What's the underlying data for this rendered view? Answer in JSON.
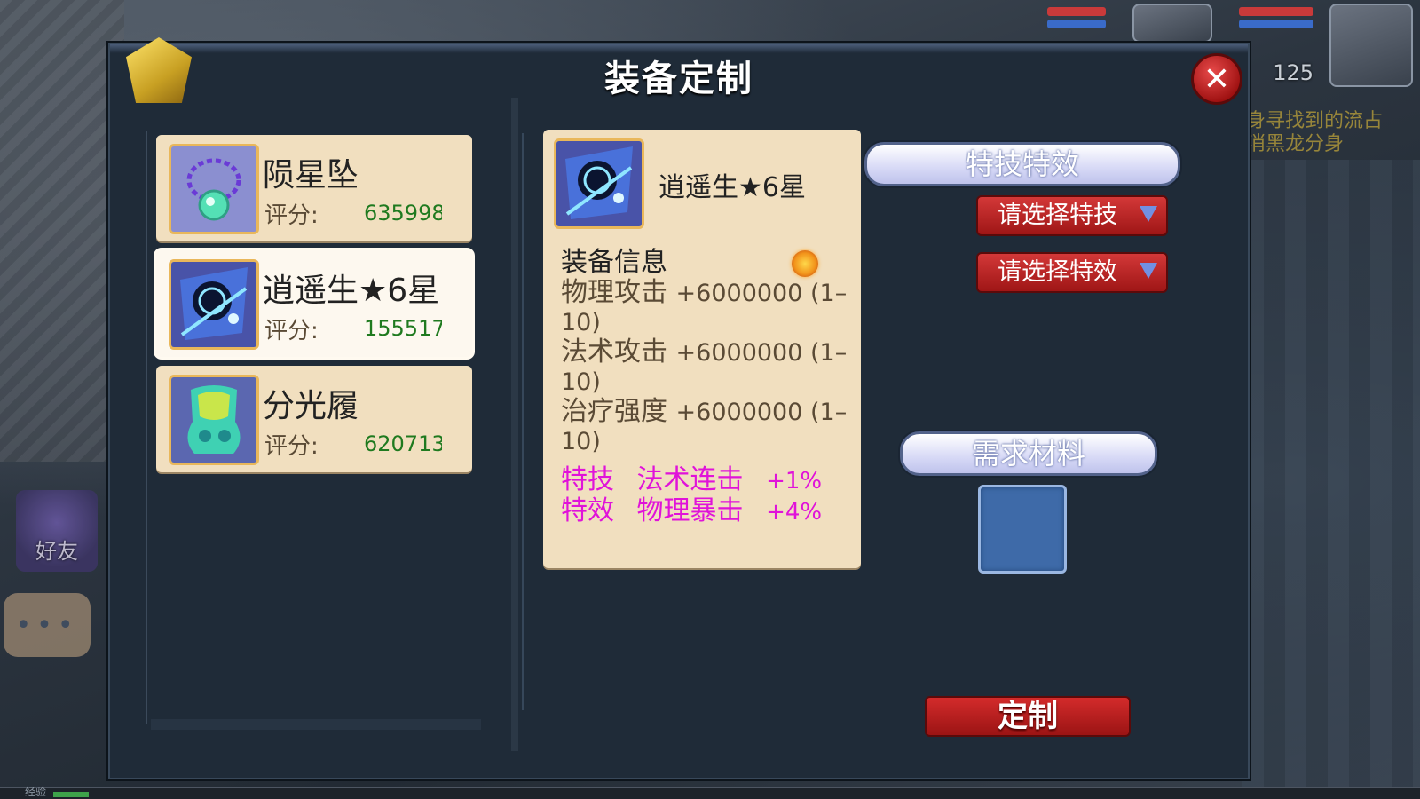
{
  "dialog": {
    "title": "装备定制",
    "close_glyph": "✕"
  },
  "equipment_list": [
    {
      "name": "陨星坠",
      "score_label": "评分:",
      "score": "635998",
      "selected": false,
      "icon": "necklace-icon"
    },
    {
      "name": "逍遥生★6星",
      "score_label": "评分:",
      "score": "155517:",
      "selected": true,
      "icon": "weapon-fan-icon"
    },
    {
      "name": "分光履",
      "score_label": "评分:",
      "score": "620713",
      "selected": false,
      "icon": "boots-icon"
    }
  ],
  "detail": {
    "name": "逍遥生★6星",
    "section_title": "装备信息",
    "stats": [
      {
        "label": "物理攻击",
        "value": "+6000000 (1–10)"
      },
      {
        "label": "法术攻击",
        "value": "+6000000 (1–10)"
      },
      {
        "label": "治疗强度",
        "value": "+6000000 (1–10)"
      }
    ],
    "extras": [
      {
        "kind": "特技",
        "name": "法术连击",
        "value": "+1%"
      },
      {
        "kind": "特效",
        "name": "物理暴击",
        "value": "+4%"
      }
    ],
    "accent_color": "#e013d9"
  },
  "right_panel": {
    "effects_header": "特技特效",
    "skill_dropdown": "请选择特技",
    "effect_dropdown": "请选择特效",
    "materials_header": "需求材料",
    "customize_button": "定制"
  },
  "hud": {
    "level": "125",
    "quest_text": "身寻找到的流占\n消黑龙分身",
    "friends_label": "好友",
    "chat_label": "•••",
    "exp_label": "经验"
  }
}
